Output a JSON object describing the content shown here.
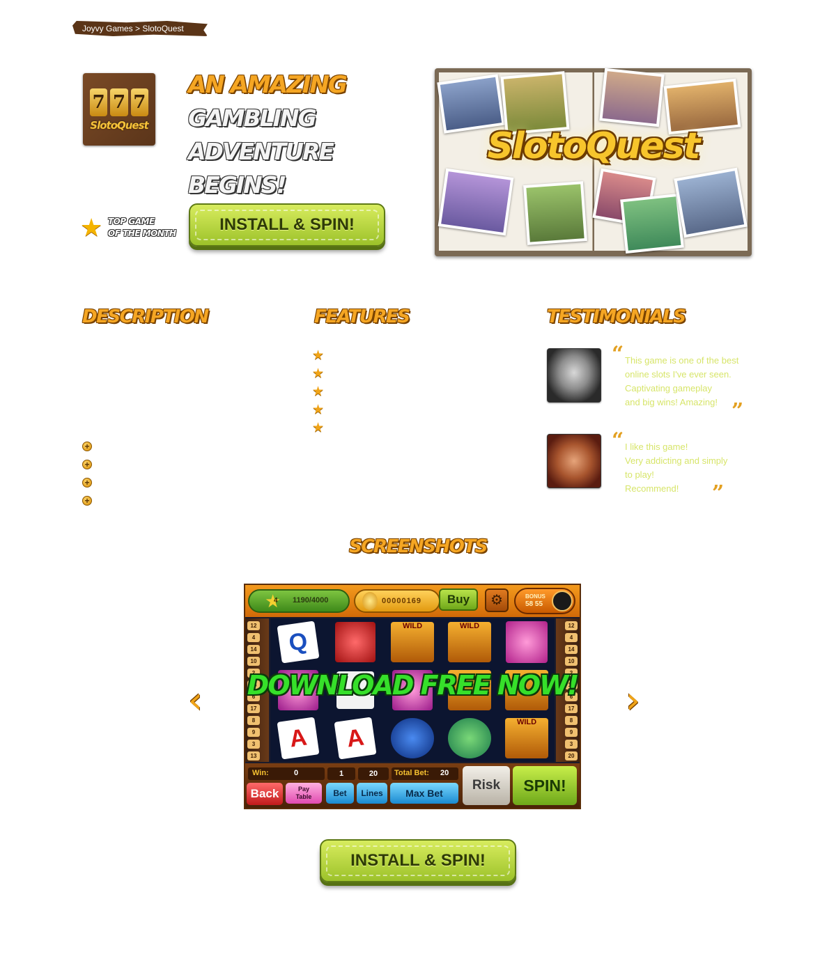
{
  "breadcrumb": {
    "text": "Joyvy Games > SlotoQuest"
  },
  "app_icon": {
    "reels": [
      "7",
      "7",
      "7"
    ],
    "logo_text": "SlotoQuest"
  },
  "headline": {
    "line1": "AN AMAZING",
    "line2": "GAMBLING ADVENTURE",
    "line3": "BEGINS!"
  },
  "badge": {
    "line1": "TOP GAME",
    "line2": "OF THE MONTH"
  },
  "install_button": {
    "label": "INSTALL & SPIN!"
  },
  "hero": {
    "title": "SlotoQuest"
  },
  "sections": {
    "description": "DESCRIPTION",
    "features": "FEATURES",
    "testimonials": "TESTIMONIALS",
    "screenshots": "SCREENSHOTS"
  },
  "testimonials": [
    {
      "lines": [
        "This game is one of the best",
        "online slots I've ever seen.",
        "Captivating gameplay",
        "and big wins! Amazing!"
      ]
    },
    {
      "lines": [
        "I like this game!",
        "Very addicting and simply",
        "to play!",
        "Recommend!"
      ]
    }
  ],
  "screenshot": {
    "level": "4",
    "xp": "1190/4000",
    "coins": "00000169",
    "buy_label": "Buy",
    "bonus_label": "BONUS",
    "bonus_time": "58 55",
    "overlay": "DOWNLOAD FREE NOW!",
    "win_label": "Win:",
    "win_value": "0",
    "lines_value": "1",
    "bet_value": "20",
    "total_bet_label": "Total Bet:",
    "total_bet_value": "20",
    "risk_label": "Risk",
    "spin_label": "SPIN!",
    "back_label": "Back",
    "paytable_line1": "Pay",
    "paytable_line2": "Table",
    "bet_label": "Bet",
    "lines_label": "Lines",
    "maxbet_label": "Max Bet",
    "left_numbers": [
      "12",
      "4",
      "14",
      "10",
      "2",
      "16",
      "6",
      "17",
      "8",
      "9",
      "3",
      "13"
    ],
    "right_numbers": [
      "12",
      "4",
      "14",
      "10",
      "2",
      "16",
      "6",
      "17",
      "8",
      "9",
      "3",
      "20"
    ],
    "wild": "WILD",
    "card_q": "Q",
    "card_a": "A"
  },
  "colors": {
    "accent": "#f5a623",
    "button_green": "#9cc22a",
    "testimonial_text": "#d7e56a",
    "crumb_bg": "#5a3417"
  }
}
